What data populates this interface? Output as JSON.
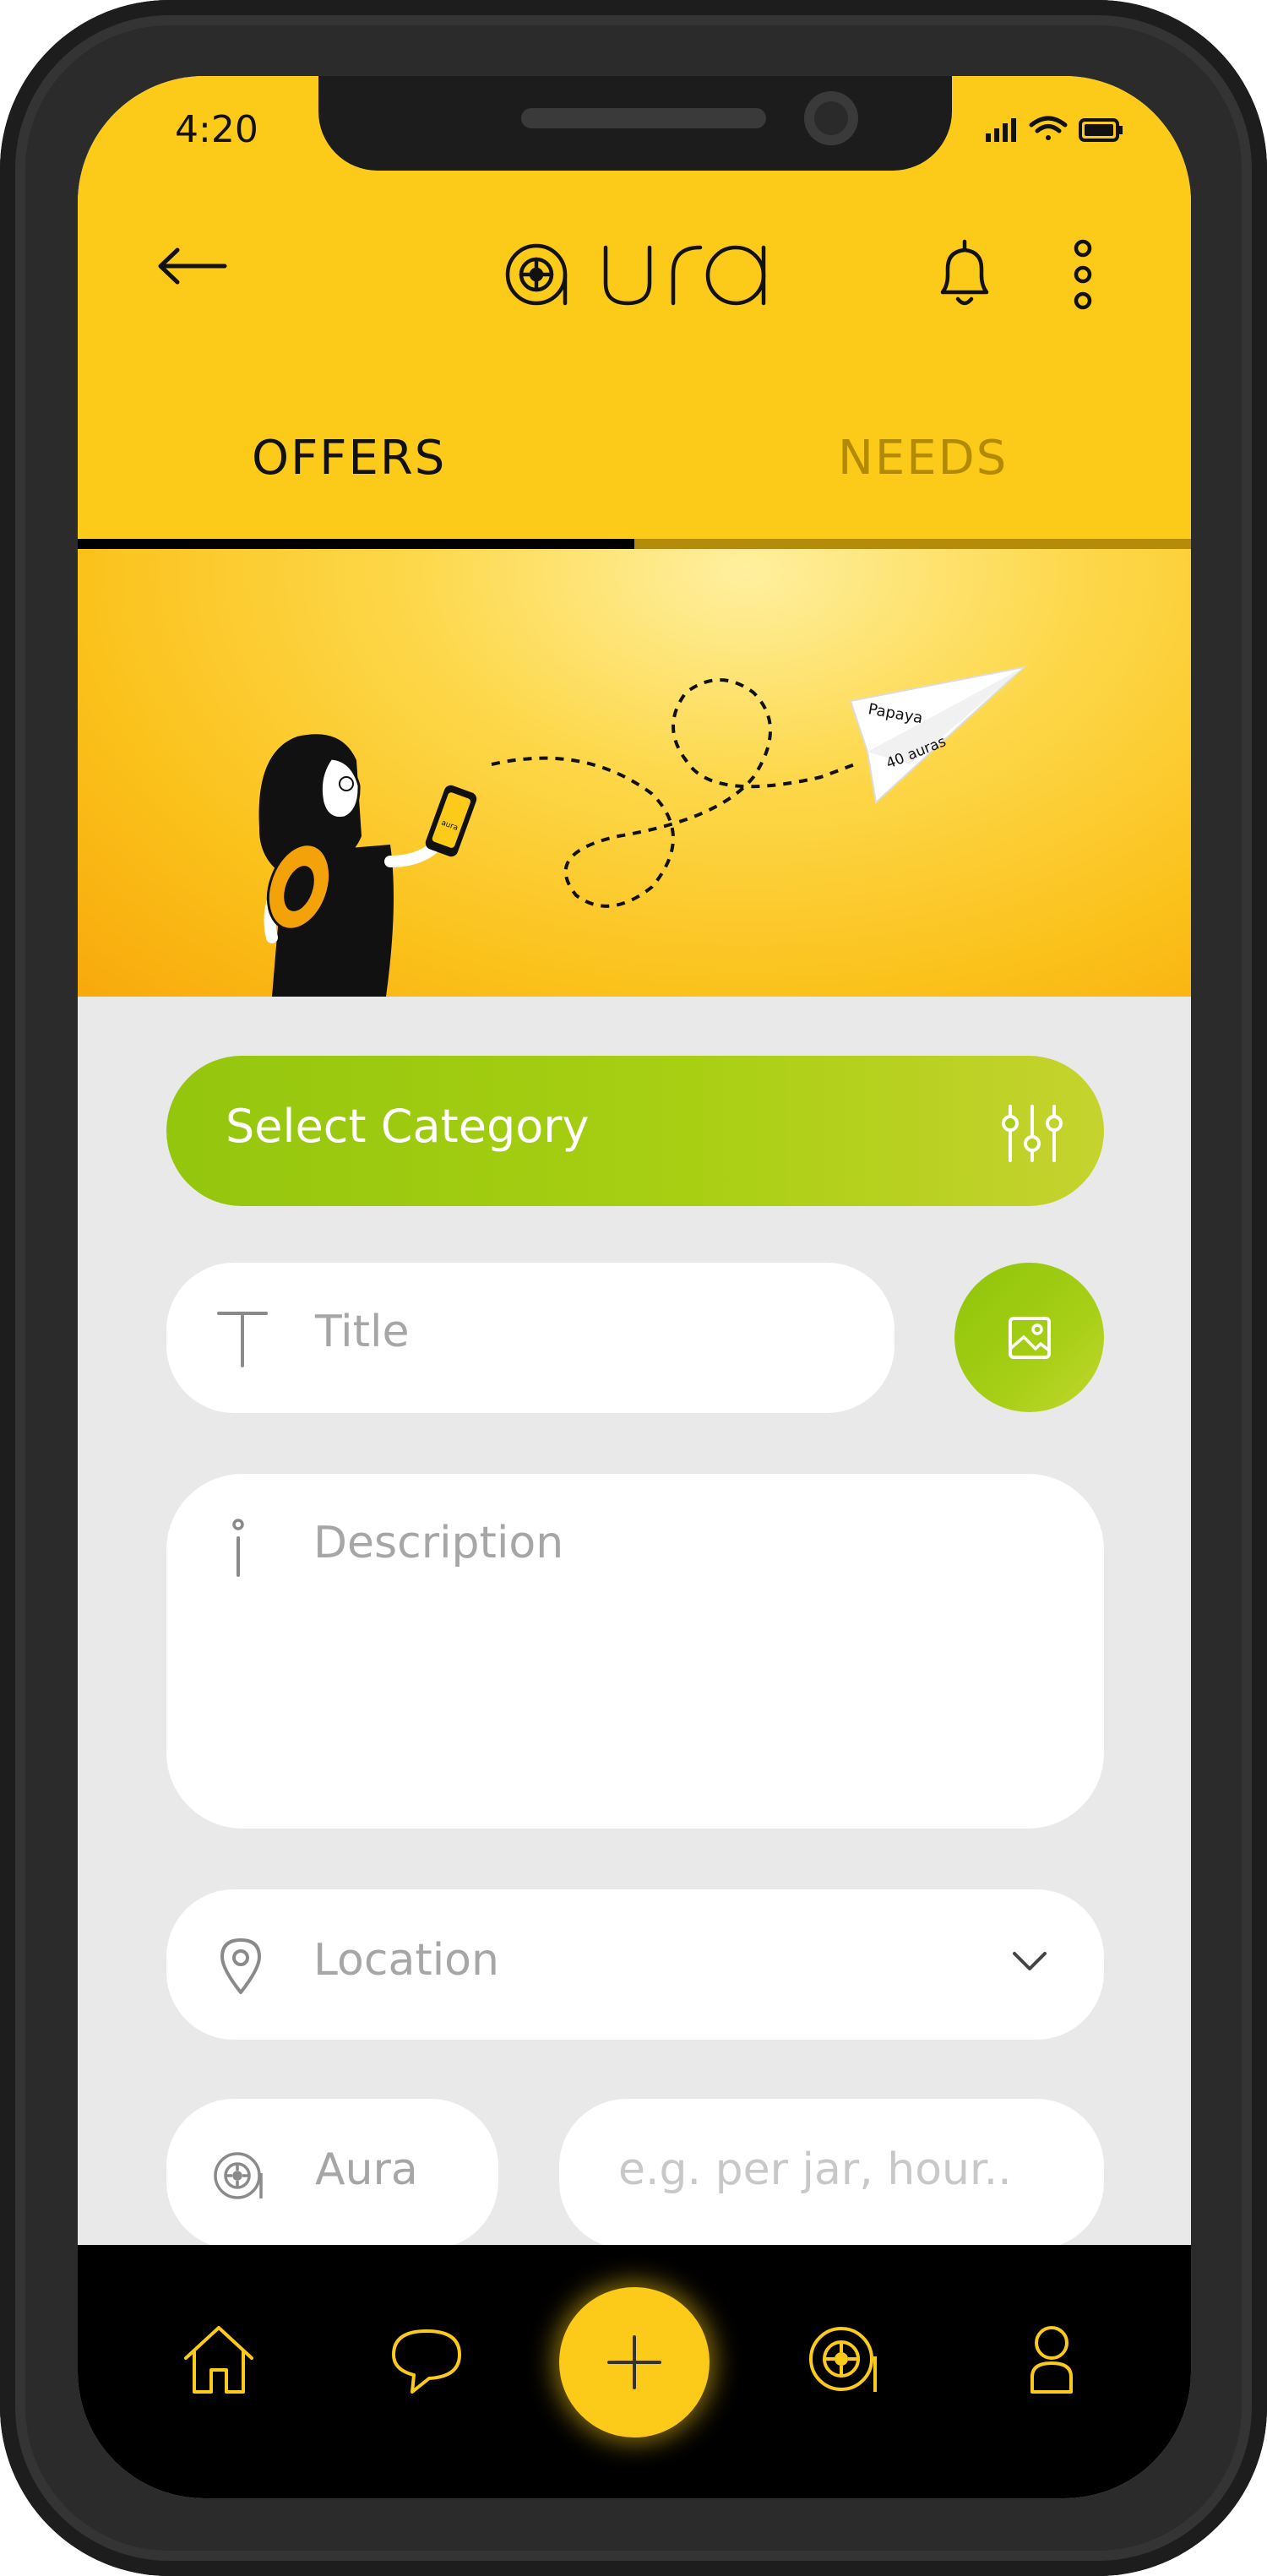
{
  "status_bar": {
    "time": "4:20"
  },
  "app_bar": {
    "logo_text": "aura",
    "back_icon": "arrow-left-icon",
    "notification_icon": "bell-icon",
    "menu_icon": "more-vertical-icon"
  },
  "tabs": [
    {
      "label": "OFFERS",
      "active": true
    },
    {
      "label": "NEEDS",
      "active": false
    }
  ],
  "banner": {
    "plane_text_1": "Papaya",
    "plane_text_2": "40 auras",
    "phone_logo_text": "aura"
  },
  "form": {
    "category_label": "Select Category",
    "title_placeholder": "Title",
    "description_placeholder": "Description",
    "location_placeholder": "Location",
    "aura_placeholder": "Aura",
    "unit_placeholder": "e.g. per jar, hour.."
  },
  "bottom_nav": {
    "items": [
      {
        "icon": "home-icon"
      },
      {
        "icon": "chat-icon"
      },
      {
        "icon": "plus-icon"
      },
      {
        "icon": "aura-coin-icon"
      },
      {
        "icon": "profile-icon"
      }
    ]
  },
  "colors": {
    "brand_yellow": "#fcca18",
    "accent_green": "#9bc90f",
    "tab_inactive": "#b38a06"
  }
}
